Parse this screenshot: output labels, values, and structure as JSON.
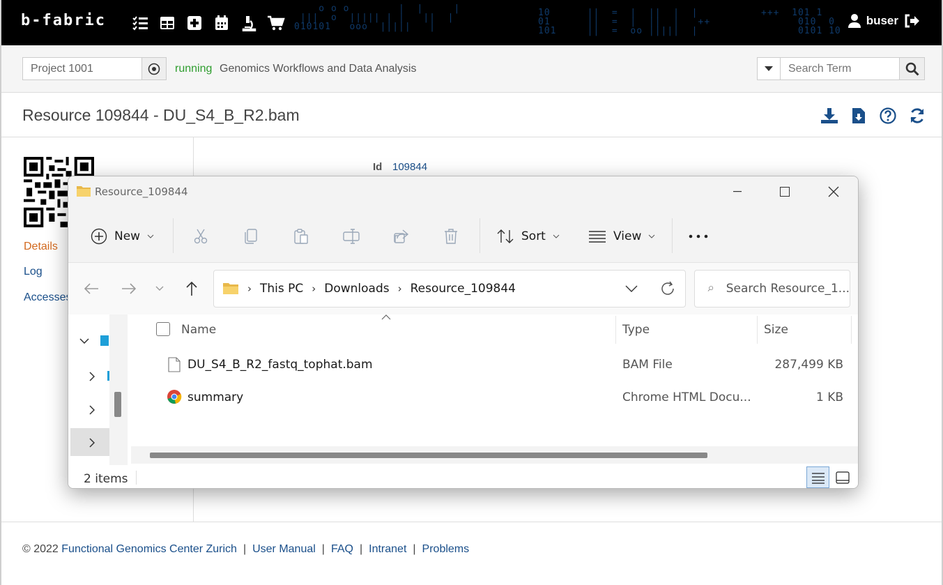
{
  "app": {
    "logo": "b-fabric",
    "user": "buser",
    "top_icons": [
      "tasks-icon",
      "grid-icon",
      "plus-icon",
      "calendar-icon",
      "microscope-icon",
      "cart-icon"
    ]
  },
  "project_bar": {
    "project_value": "Project 1001",
    "status": "running",
    "project_name": "Genomics Workflows and Data Analysis",
    "search_placeholder": "Search Term"
  },
  "page": {
    "title": "Resource 109844 - DU_S4_B_R2.bam",
    "id_label": "Id",
    "id_value": "109844"
  },
  "sidenav": {
    "items": [
      {
        "label": "Details"
      },
      {
        "label": "Log"
      },
      {
        "label": "Accesses"
      }
    ]
  },
  "explorer": {
    "title": "Resource_109844",
    "toolbar": {
      "new": "New",
      "sort": "Sort",
      "view": "View"
    },
    "address": {
      "segments": [
        "This PC",
        "Downloads",
        "Resource_109844"
      ]
    },
    "search_placeholder": "Search Resource_1...",
    "columns": {
      "name": "Name",
      "type": "Type",
      "size": "Size"
    },
    "files": [
      {
        "name": "DU_S4_B_R2_fastq_tophat.bam",
        "type": "BAM File",
        "size": "287,499 KB",
        "icon": "file-icon"
      },
      {
        "name": "summary",
        "type": "Chrome HTML Docu...",
        "size": "1 KB",
        "icon": "chrome-icon"
      }
    ],
    "status": "2 items"
  },
  "footer": {
    "copyright": "© 2022",
    "links": [
      "Functional Genomics Center Zurich",
      "User Manual",
      "FAQ",
      "Intranet",
      "Problems"
    ]
  },
  "colors": {
    "status_green": "#2e9d2e",
    "link_blue": "#1a4f8a",
    "active_orange": "#d2691e",
    "topbar_bg": "#000000"
  }
}
